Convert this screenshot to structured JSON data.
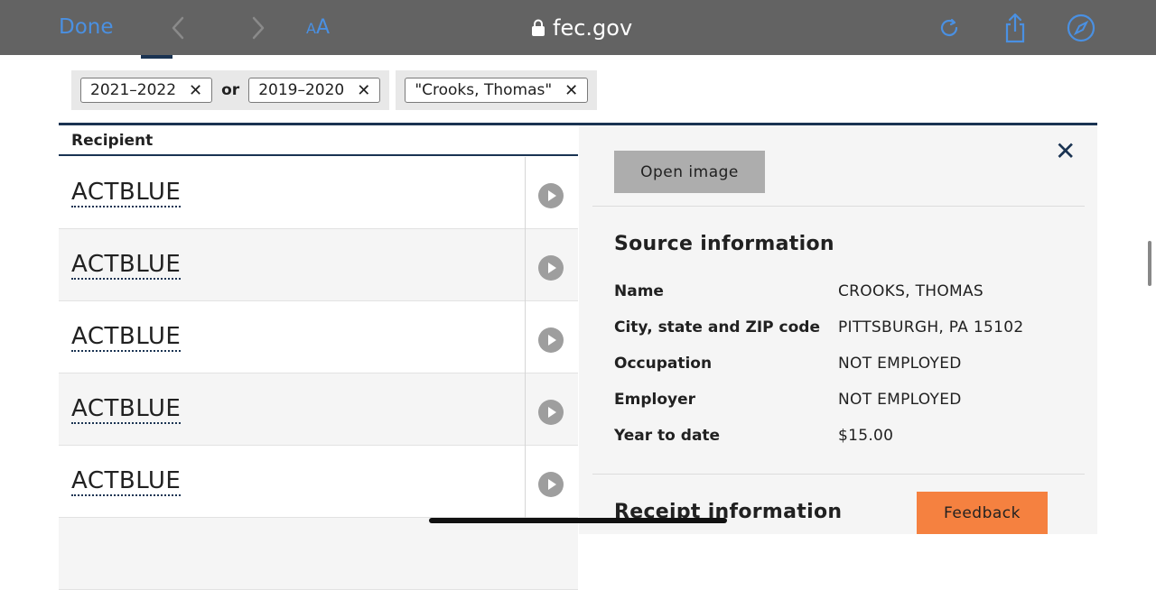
{
  "browser": {
    "done_label": "Done",
    "text_size_small": "A",
    "text_size_big": "A",
    "url": "fec.gov",
    "accent": "#4a90e2"
  },
  "filters": {
    "group1": [
      {
        "label": "2021–2022"
      },
      {
        "label": "2019–2020"
      }
    ],
    "or_label": "or",
    "group2": [
      {
        "label": "\"Crooks, Thomas\""
      }
    ]
  },
  "table": {
    "header": "Recipient",
    "rows": [
      {
        "recipient": "ACTBLUE"
      },
      {
        "recipient": "ACTBLUE"
      },
      {
        "recipient": "ACTBLUE"
      },
      {
        "recipient": "ACTBLUE"
      },
      {
        "recipient": "ACTBLUE"
      }
    ]
  },
  "panel": {
    "open_image_label": "Open image",
    "source_title": "Source information",
    "fields": [
      {
        "label": "Name",
        "value": "CROOKS, THOMAS"
      },
      {
        "label": "City, state and ZIP code",
        "value": "PITTSBURGH, PA 15102"
      },
      {
        "label": "Occupation",
        "value": "NOT EMPLOYED"
      },
      {
        "label": "Employer",
        "value": "NOT EMPLOYED"
      },
      {
        "label": "Year to date",
        "value": "$15.00"
      }
    ],
    "receipt_title": "Receipt information"
  },
  "feedback_label": "Feedback",
  "colors": {
    "navy": "#1a3352",
    "feedback": "#f58140",
    "button_gray": "#adadad"
  }
}
